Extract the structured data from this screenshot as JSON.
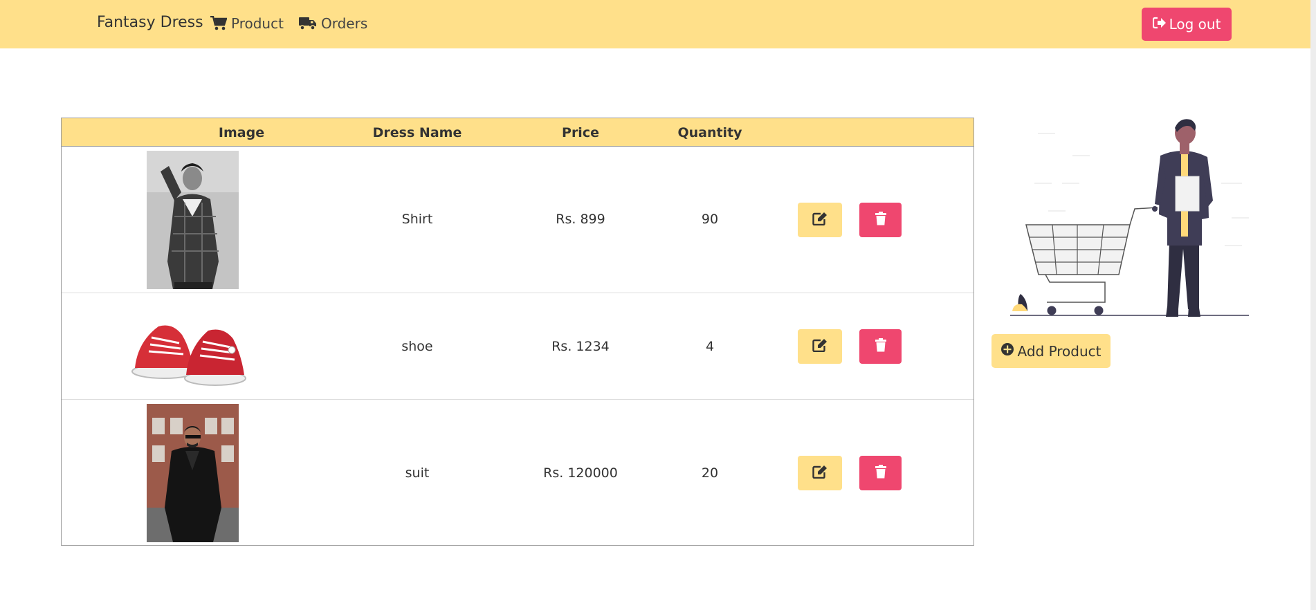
{
  "navbar": {
    "brand": "Fantasy Dress",
    "links": [
      {
        "label": "Product",
        "icon": "cart-icon"
      },
      {
        "label": "Orders",
        "icon": "truck-icon"
      }
    ],
    "logout_label": "Log out",
    "logout_icon": "sign-out-icon"
  },
  "table": {
    "headers": [
      "Image",
      "Dress Name",
      "Price",
      "Quantity",
      ""
    ],
    "rows": [
      {
        "image": "man in checked shirt photo",
        "name": "Shirt",
        "price": "Rs. 899",
        "quantity": "90"
      },
      {
        "image": "red sneakers photo",
        "name": "shoe",
        "price": "Rs. 1234",
        "quantity": "4"
      },
      {
        "image": "man in black suit photo",
        "name": "suit",
        "price": "Rs. 120000",
        "quantity": "20"
      }
    ],
    "edit_icon": "edit-icon",
    "delete_icon": "trash-icon"
  },
  "sidebar": {
    "illustration": "shopping-cart-person-illustration",
    "add_label": "Add Product",
    "add_icon": "plus-circle-icon"
  },
  "colors": {
    "accent_yellow": "#ffe08a",
    "accent_red": "#ef476f"
  }
}
